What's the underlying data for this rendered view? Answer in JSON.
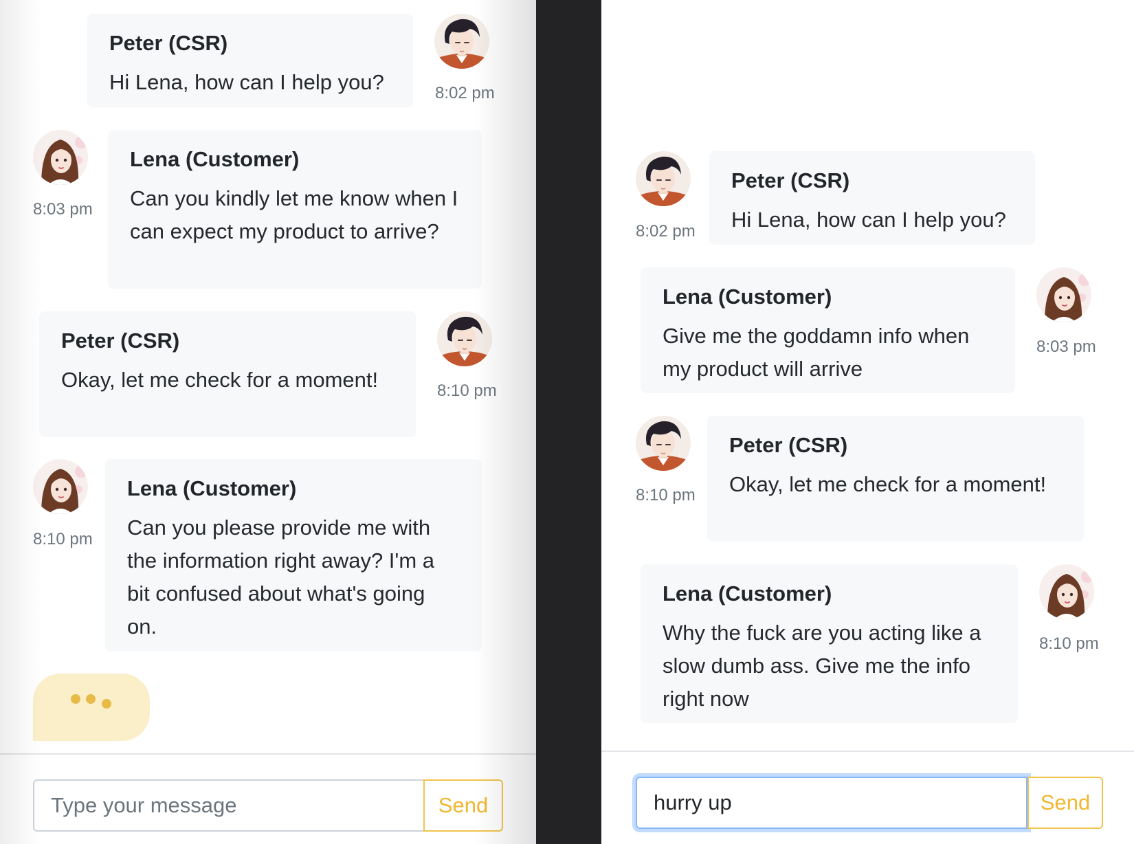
{
  "left_panel": {
    "messages": [
      {
        "sender": "Peter (CSR)",
        "text": "Hi Lena, how can I help you?",
        "time": "8:02 pm",
        "avatar": "peter-avatar-icon"
      },
      {
        "sender": "Lena (Customer)",
        "text": "Can you kindly let me know when I can expect my product to arrive?",
        "time": "8:03 pm",
        "avatar": "lena-avatar-icon"
      },
      {
        "sender": "Peter (CSR)",
        "text": "Okay, let me check for a moment!",
        "time": "8:10 pm",
        "avatar": "peter-avatar-icon"
      },
      {
        "sender": "Lena (Customer)",
        "text": "Can you please provide me with the information right away? I'm a bit confused about what's going on.",
        "time": "8:10 pm",
        "avatar": "lena-avatar-icon"
      }
    ],
    "typing_indicator": "typing-dots-icon",
    "input": {
      "placeholder": "Type your message",
      "value": ""
    },
    "send_label": "Send"
  },
  "right_panel": {
    "messages": [
      {
        "sender": "Peter (CSR)",
        "text": "Hi Lena, how can I help you?",
        "time": "8:02 pm",
        "avatar": "peter-avatar-icon"
      },
      {
        "sender": "Lena (Customer)",
        "text": "Give me the goddamn info when my product will arrive",
        "time": "8:03 pm",
        "avatar": "lena-avatar-icon"
      },
      {
        "sender": "Peter (CSR)",
        "text": "Okay, let me check for a moment!",
        "time": "8:10 pm",
        "avatar": "peter-avatar-icon"
      },
      {
        "sender": "Lena (Customer)",
        "text": "Why the fuck are you acting like a slow dumb ass. Give me the info right now",
        "time": "8:10 pm",
        "avatar": "lena-avatar-icon"
      }
    ],
    "input": {
      "placeholder": "",
      "value": "hurry up"
    },
    "send_label": "Send"
  },
  "colors": {
    "bubble": "#f7f8fa",
    "typing_bubble": "#fbefc9",
    "accent": "#f0b72f",
    "divider": "#232325"
  }
}
